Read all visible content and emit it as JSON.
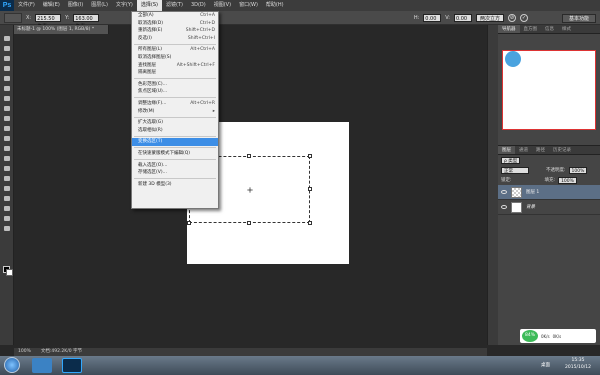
{
  "app": {
    "logo": "Ps"
  },
  "menubar": {
    "items": [
      "文件(F)",
      "编辑(E)",
      "图像(I)",
      "图层(L)",
      "文字(Y)",
      "选择(S)",
      "滤镜(T)",
      "3D(D)",
      "视图(V)",
      "窗口(W)",
      "帮助(H)"
    ],
    "active_index": 5
  },
  "options_bar": {
    "x_label": "X:",
    "x_value": "215.50 像素",
    "y_label": "Y:",
    "y_value": "163.00 像素",
    "h_label": "H:",
    "h_value": "0.00",
    "v_label": "V:",
    "v_value": "0.00",
    "interp_value": "两次立方",
    "workspace": "基本功能"
  },
  "document_tab": "未标题-1 @ 100% (图层 1, RGB/8) *",
  "select_menu": {
    "items": [
      {
        "label": "全部(A)",
        "shortcut": "Ctrl+A",
        "state": "normal"
      },
      {
        "label": "取消选择(D)",
        "shortcut": "Ctrl+D",
        "state": "normal"
      },
      {
        "label": "重新选择(E)",
        "shortcut": "Shift+Ctrl+D",
        "state": "normal"
      },
      {
        "label": "反选(I)",
        "shortcut": "Shift+Ctrl+I",
        "state": "normal"
      },
      {
        "sep": true
      },
      {
        "label": "所有图层(L)",
        "shortcut": "Alt+Ctrl+A",
        "state": "normal"
      },
      {
        "label": "取消选择图层(S)",
        "shortcut": "",
        "state": "normal"
      },
      {
        "label": "查找图层",
        "shortcut": "Alt+Shift+Ctrl+F",
        "state": "normal"
      },
      {
        "label": "隔离图层",
        "shortcut": "",
        "state": "normal"
      },
      {
        "sep": true
      },
      {
        "label": "色彩范围(C)...",
        "shortcut": "",
        "state": "normal"
      },
      {
        "label": "焦点区域(U)...",
        "shortcut": "",
        "state": "normal"
      },
      {
        "sep": true
      },
      {
        "label": "调整边缘(F)...",
        "shortcut": "Alt+Ctrl+R",
        "state": "normal"
      },
      {
        "label": "修改(M)",
        "shortcut": "▸",
        "state": "normal"
      },
      {
        "sep": true
      },
      {
        "label": "扩大选取(G)",
        "shortcut": "",
        "state": "normal"
      },
      {
        "label": "选取相似(R)",
        "shortcut": "",
        "state": "normal"
      },
      {
        "sep": true
      },
      {
        "label": "变换选区(T)",
        "shortcut": "",
        "state": "highlighted"
      },
      {
        "sep": true
      },
      {
        "label": "在快速蒙版模式下编辑(Q)",
        "shortcut": "",
        "state": "normal"
      },
      {
        "sep": true
      },
      {
        "label": "载入选区(O)...",
        "shortcut": "",
        "state": "normal"
      },
      {
        "label": "存储选区(V)...",
        "shortcut": "",
        "state": "normal"
      },
      {
        "sep": true
      },
      {
        "label": "新建 3D 模型(3)",
        "shortcut": "",
        "state": "normal"
      }
    ]
  },
  "navigator": {
    "tabs": [
      "导航器",
      "直方图",
      "信息",
      "样式"
    ]
  },
  "layers_panel": {
    "tabs": [
      "图层",
      "通道",
      "路径",
      "历史记录"
    ],
    "filter_label": "ρ 类型",
    "blend_mode": "正常",
    "opacity_label": "不透明度:",
    "opacity_value": "100%",
    "lock_label": "锁定:",
    "fill_label": "填充:",
    "fill_value": "100%",
    "layers": [
      {
        "name": "图层 1",
        "selected": true,
        "transparent": true
      },
      {
        "name": "背景",
        "selected": false,
        "transparent": false
      }
    ]
  },
  "statusbar": {
    "zoom": "100%",
    "doc_info": "文档:492.2K/0 字节"
  },
  "taskbar": {
    "desktop_label": "桌面",
    "time": "15:35",
    "date": "2015/10/12",
    "tray_percent": "84%",
    "tray_up": "0K/s",
    "tray_down": "0K/s"
  }
}
